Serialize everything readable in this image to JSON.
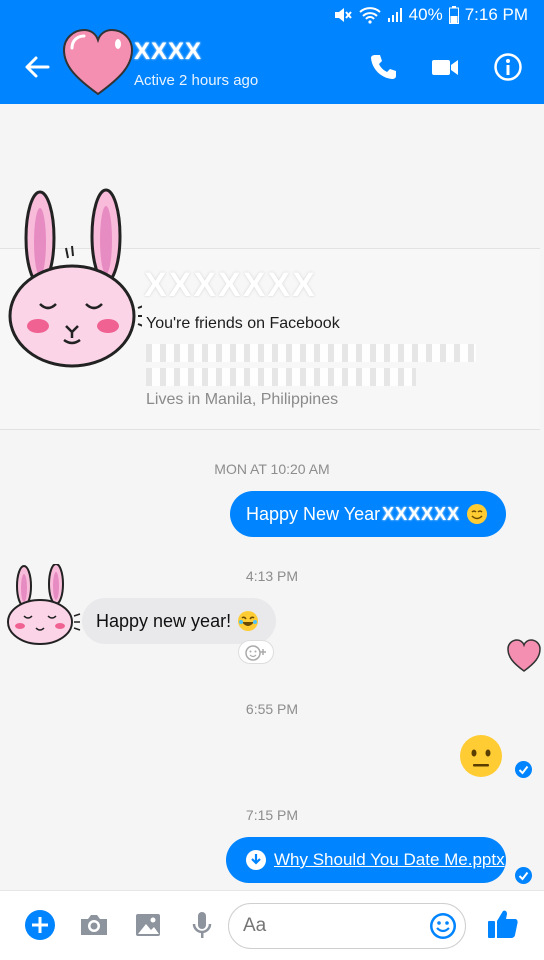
{
  "status_bar": {
    "battery": "40%",
    "time": "7:16 PM"
  },
  "header": {
    "contact_name": "XXXX",
    "active_status": "Active 2 hours ago"
  },
  "profile": {
    "name_redacted": "XXXXXXX",
    "friends_line": "You're friends on Facebook",
    "lives_in": "Lives in Manila, Philippines"
  },
  "messages": {
    "ts1": "MON AT 10:20 AM",
    "sent1_text": "Happy New Year",
    "sent1_redacted": "XXXXXX",
    "ts2": "4:13 PM",
    "received1_text": "Happy new year!",
    "ts3": "6:55 PM",
    "ts4": "7:15 PM",
    "file_name": "Why Should You Date Me.pptx"
  },
  "composer": {
    "placeholder": "Aa"
  },
  "colors": {
    "accent": "#0084ff",
    "bubble_in": "#e9e9eb",
    "heart": "#f48fb1"
  },
  "icons": [
    "back-arrow-icon",
    "phone-icon",
    "video-camera-icon",
    "info-icon",
    "plus-icon",
    "camera-icon",
    "gallery-icon",
    "microphone-icon",
    "emoji-icon",
    "thumbs-up-icon",
    "download-icon",
    "check-icon"
  ]
}
